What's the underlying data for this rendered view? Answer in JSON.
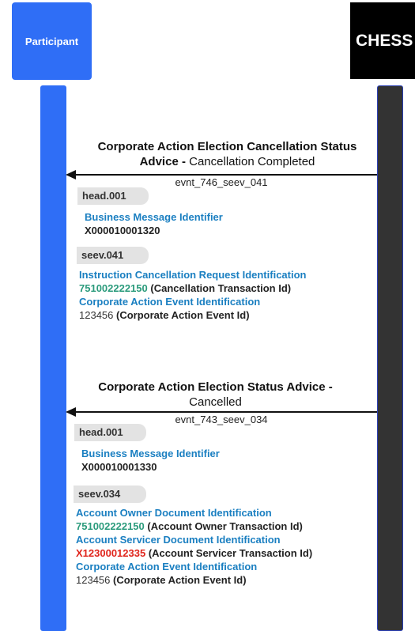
{
  "actors": {
    "participant": "Participant",
    "chess": "CHESS"
  },
  "message1": {
    "title_bold": "Corporate Action Election Cancellation Status Advice -",
    "title_rest": "Cancellation Completed",
    "event": "evnt_746_seev_041",
    "head_tag": "head.001",
    "head_field_label": "Business Message Identifier",
    "head_field_value": "X000010001320",
    "body_tag": "seev.041",
    "fields": {
      "f1_label": "Instruction Cancellation Request Identification",
      "f1_value": "751002222150",
      "f1_desc": "(Cancellation Transaction Id)",
      "f2_label": "Corporate Action Event Identification",
      "f2_value": "123456",
      "f2_desc": "(Corporate Action Event Id)"
    }
  },
  "message2": {
    "title_bold": "Corporate Action Election Status Advice -",
    "title_rest": "Cancelled",
    "event": "evnt_743_seev_034",
    "head_tag": "head.001",
    "head_field_label": "Business Message Identifier",
    "head_field_value": "X000010001330",
    "body_tag": "seev.034",
    "fields": {
      "f1_label": "Account Owner Document Identification",
      "f1_value": "751002222150",
      "f1_desc": "(Account Owner Transaction Id)",
      "f2_label": "Account Servicer Document Identification",
      "f2_value": "X12300012335",
      "f2_desc": "(Account Servicer Transaction Id)",
      "f3_label": "Corporate Action Event Identification",
      "f3_value": "123456",
      "f3_desc": "(Corporate Action Event Id)"
    }
  },
  "colors": {
    "participant": "#2f6ef6",
    "chess": "#000000",
    "label_blue": "#1a7fc1",
    "value_green": "#2b9b7c",
    "value_red": "#e0241b"
  }
}
